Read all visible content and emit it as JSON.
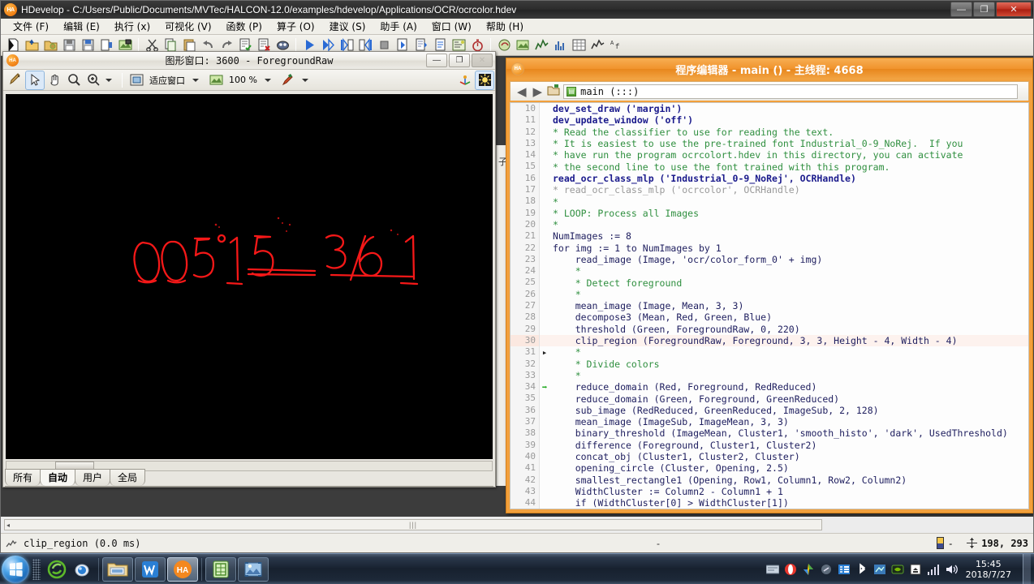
{
  "window": {
    "title": "HDevelop - C:/Users/Public/Documents/MVTec/HALCON-12.0/examples/hdevelop/Applications/OCR/ocrcolor.hdev",
    "logo": "HA",
    "minimize": "—",
    "maximize": "❐",
    "close": "✕"
  },
  "menubar": {
    "items": [
      {
        "label": "文件 (F)",
        "name": "menu-file"
      },
      {
        "label": "编辑 (E)",
        "name": "menu-edit"
      },
      {
        "label": "执行 (x)",
        "name": "menu-execute"
      },
      {
        "label": "可视化 (V)",
        "name": "menu-visualization"
      },
      {
        "label": "函数 (P)",
        "name": "menu-procedures"
      },
      {
        "label": "算子 (O)",
        "name": "menu-operators"
      },
      {
        "label": "建议 (S)",
        "name": "menu-suggestions"
      },
      {
        "label": "助手 (A)",
        "name": "menu-assistants"
      },
      {
        "label": "窗口 (W)",
        "name": "menu-window"
      },
      {
        "label": "帮助 (H)",
        "name": "menu-help"
      }
    ]
  },
  "toolbar": {
    "groups": [
      [
        "new-program-icon",
        "open-program-icon",
        "open-recent-icon",
        "save-program-icon",
        "save-as-icon",
        "insert-program-icon",
        "image-acquisition-icon"
      ],
      [
        "cut-icon",
        "copy-icon",
        "paste-icon",
        "undo-icon",
        "redo-icon",
        "activate-code-icon",
        "deactivate-code-icon",
        "comment-icon"
      ],
      [
        "run-icon",
        "step-over-icon",
        "step-into-icon",
        "step-out-icon",
        "stop-icon",
        "reset-program-icon",
        "new-procedure-icon",
        "edit-procedure-icon",
        "variable-window-icon",
        "stopwatch-icon"
      ],
      [
        "halcon-operator-icon",
        "image-window-icon",
        "feature-histogram-icon",
        "gray-histogram-icon",
        "matrix-icon",
        "profile-icon",
        "text-icon"
      ]
    ]
  },
  "graphics_window": {
    "logo": "HA",
    "title": "图形窗口: 3600 - ForegroundRaw",
    "buttons": {
      "minimize": "—",
      "maximize": "❐",
      "close": "✕"
    },
    "toolbar": {
      "icons": [
        "draw-region-icon",
        "select-pointer-icon",
        "pan-hand-icon",
        "zoom-out-icon",
        "zoom-in-icon"
      ],
      "fit_mode": "适应窗口",
      "zoom_level": "100 %",
      "color-pen-icon": "color-pen-icon",
      "right_icons": [
        "3d-axis-icon",
        "lighting-icon"
      ]
    },
    "tabs": [
      {
        "label": "所有",
        "active": false
      },
      {
        "label": "自动",
        "active": true
      },
      {
        "label": "用户",
        "active": false
      },
      {
        "label": "全局",
        "active": false
      }
    ],
    "canvas_caption": "ForegroundRaw region overlay: red contour outlines of digits 005 15 361 on black background"
  },
  "background_panel": {
    "text": "子"
  },
  "editor": {
    "logo": "HA",
    "title": "程序编辑器 - main () - 主线程: 4668",
    "nav": {
      "back-icon": "◀",
      "forward-icon": "▶",
      "open-procedure-icon": "open-procedure-icon",
      "breadcrumb_icon": "procedure-icon",
      "breadcrumb": "main (:::)"
    },
    "code_lines": [
      {
        "n": "10",
        "marker": "",
        "hl": false,
        "segs": [
          {
            "t": "dev_set_draw ('margin')",
            "c": "c-kw"
          }
        ]
      },
      {
        "n": "11",
        "marker": "",
        "hl": false,
        "segs": [
          {
            "t": "dev_update_window ('off')",
            "c": "c-kw"
          }
        ]
      },
      {
        "n": "12",
        "marker": "",
        "hl": false,
        "segs": [
          {
            "t": "* Read the classifier to use for reading the text.",
            "c": "c-cmt"
          }
        ]
      },
      {
        "n": "13",
        "marker": "",
        "hl": false,
        "segs": [
          {
            "t": "* It is easiest to use the pre-trained font Industrial_0-9_NoRej.  If you",
            "c": "c-cmt"
          }
        ]
      },
      {
        "n": "14",
        "marker": "",
        "hl": false,
        "segs": [
          {
            "t": "* have run the program ocrcolort.hdev in this directory, you can activate",
            "c": "c-cmt"
          }
        ]
      },
      {
        "n": "15",
        "marker": "",
        "hl": false,
        "segs": [
          {
            "t": "* the second line to use the font trained with this program.",
            "c": "c-cmt"
          }
        ]
      },
      {
        "n": "16",
        "marker": "",
        "hl": false,
        "segs": [
          {
            "t": "read_ocr_class_mlp ('Industrial_0-9_NoRej', OCRHandle)",
            "c": "c-kw"
          }
        ]
      },
      {
        "n": "17",
        "marker": "",
        "hl": false,
        "segs": [
          {
            "t": "* read_ocr_class_mlp ('ocrcolor', OCRHandle)",
            "c": "c-cmt-dim"
          }
        ]
      },
      {
        "n": "18",
        "marker": "",
        "hl": false,
        "segs": [
          {
            "t": "*",
            "c": "c-cmt"
          }
        ]
      },
      {
        "n": "19",
        "marker": "",
        "hl": false,
        "segs": [
          {
            "t": "* LOOP: Process all Images",
            "c": "c-cmt"
          }
        ]
      },
      {
        "n": "20",
        "marker": "",
        "hl": false,
        "segs": [
          {
            "t": "*",
            "c": "c-cmt"
          }
        ]
      },
      {
        "n": "21",
        "marker": "",
        "hl": false,
        "segs": [
          {
            "t": "NumImages := 8",
            "c": "c-plain"
          }
        ]
      },
      {
        "n": "22",
        "marker": "",
        "hl": false,
        "segs": [
          {
            "t": "for img := 1 to NumImages by 1",
            "c": "c-plain"
          }
        ]
      },
      {
        "n": "23",
        "marker": "",
        "hl": false,
        "segs": [
          {
            "t": "    read_image (Image, 'ocr/color_form_0' + img)",
            "c": "c-plain"
          }
        ]
      },
      {
        "n": "24",
        "marker": "",
        "hl": false,
        "segs": [
          {
            "t": "    *",
            "c": "c-cmt"
          }
        ]
      },
      {
        "n": "25",
        "marker": "",
        "hl": false,
        "segs": [
          {
            "t": "    * Detect foreground",
            "c": "c-cmt"
          }
        ]
      },
      {
        "n": "26",
        "marker": "",
        "hl": false,
        "segs": [
          {
            "t": "    *",
            "c": "c-cmt"
          }
        ]
      },
      {
        "n": "27",
        "marker": "",
        "hl": false,
        "segs": [
          {
            "t": "    mean_image (Image, Mean, 3, 3)",
            "c": "c-plain"
          }
        ]
      },
      {
        "n": "28",
        "marker": "",
        "hl": false,
        "segs": [
          {
            "t": "    decompose3 (Mean, Red, Green, Blue)",
            "c": "c-plain"
          }
        ]
      },
      {
        "n": "29",
        "marker": "",
        "hl": false,
        "segs": [
          {
            "t": "    threshold (Green, ForegroundRaw, 0, 220)",
            "c": "c-plain"
          }
        ]
      },
      {
        "n": "30",
        "marker": "",
        "hl": true,
        "segs": [
          {
            "t": "    clip_region (ForegroundRaw, Foreground, 3, 3, Height - 4, Width - 4)",
            "c": "c-plain"
          }
        ]
      },
      {
        "n": "31",
        "marker": "▸",
        "hl": false,
        "segs": [
          {
            "t": "    *",
            "c": "c-cmt"
          }
        ]
      },
      {
        "n": "32",
        "marker": "",
        "hl": false,
        "segs": [
          {
            "t": "    * Divide colors",
            "c": "c-cmt"
          }
        ]
      },
      {
        "n": "33",
        "marker": "",
        "hl": false,
        "segs": [
          {
            "t": "    *",
            "c": "c-cmt"
          }
        ]
      },
      {
        "n": "34",
        "marker": "➡",
        "hl": false,
        "segs": [
          {
            "t": "    reduce_domain (Red, Foreground, RedReduced)",
            "c": "c-plain"
          }
        ]
      },
      {
        "n": "35",
        "marker": "",
        "hl": false,
        "segs": [
          {
            "t": "    reduce_domain (Green, Foreground, GreenReduced)",
            "c": "c-plain"
          }
        ]
      },
      {
        "n": "36",
        "marker": "",
        "hl": false,
        "segs": [
          {
            "t": "    sub_image (RedReduced, GreenReduced, ImageSub, 2, 128)",
            "c": "c-plain"
          }
        ]
      },
      {
        "n": "37",
        "marker": "",
        "hl": false,
        "segs": [
          {
            "t": "    mean_image (ImageSub, ImageMean, 3, 3)",
            "c": "c-plain"
          }
        ]
      },
      {
        "n": "38",
        "marker": "",
        "hl": false,
        "segs": [
          {
            "t": "    binary_threshold (ImageMean, Cluster1, 'smooth_histo', 'dark', UsedThreshold)",
            "c": "c-plain"
          }
        ]
      },
      {
        "n": "39",
        "marker": "",
        "hl": false,
        "segs": [
          {
            "t": "    difference (Foreground, Cluster1, Cluster2)",
            "c": "c-plain"
          }
        ]
      },
      {
        "n": "40",
        "marker": "",
        "hl": false,
        "segs": [
          {
            "t": "    concat_obj (Cluster1, Cluster2, Cluster)",
            "c": "c-plain"
          }
        ]
      },
      {
        "n": "41",
        "marker": "",
        "hl": false,
        "segs": [
          {
            "t": "    opening_circle (Cluster, Opening, 2.5)",
            "c": "c-plain"
          }
        ]
      },
      {
        "n": "42",
        "marker": "",
        "hl": false,
        "segs": [
          {
            "t": "    smallest_rectangle1 (Opening, Row1, Column1, Row2, Column2)",
            "c": "c-plain"
          }
        ]
      },
      {
        "n": "43",
        "marker": "",
        "hl": false,
        "segs": [
          {
            "t": "    WidthCluster := Column2 - Column1 + 1",
            "c": "c-plain"
          }
        ]
      },
      {
        "n": "44",
        "marker": "",
        "hl": false,
        "segs": [
          {
            "t": "    if (WidthCluster[0] > WidthCluster[1])",
            "c": "c-plain"
          }
        ]
      }
    ]
  },
  "statusbar": {
    "operator_text": "clip_region (0.0 ms)",
    "dash": "-",
    "coordinates": "198, 293",
    "scroll_handle": "|||",
    "scroll_left_arrow": "◂"
  },
  "taskbar": {
    "start_label": "start-orb",
    "quick_launch": [
      "edge-browser-icon",
      "video-camera-icon"
    ],
    "apps": [
      {
        "name": "file-explorer-icon",
        "active": false
      },
      {
        "name": "wps-writer-icon",
        "active": false
      },
      {
        "name": "halcon-hdevelop-icon",
        "active": true
      },
      {
        "name": "excel-icon",
        "active": false
      },
      {
        "name": "photo-viewer-icon",
        "active": false
      }
    ],
    "tray": [
      "keyboard-layout-icon",
      "opera-icon",
      "cloud-drive-icon",
      "hidden-icon",
      "tasks-icon",
      "bluetooth-icon",
      "network-center-icon",
      "nvidia-icon",
      "usb-eject-icon",
      "signal-icon",
      "volume-icon"
    ],
    "time": "15:45",
    "date": "2018/7/27"
  }
}
